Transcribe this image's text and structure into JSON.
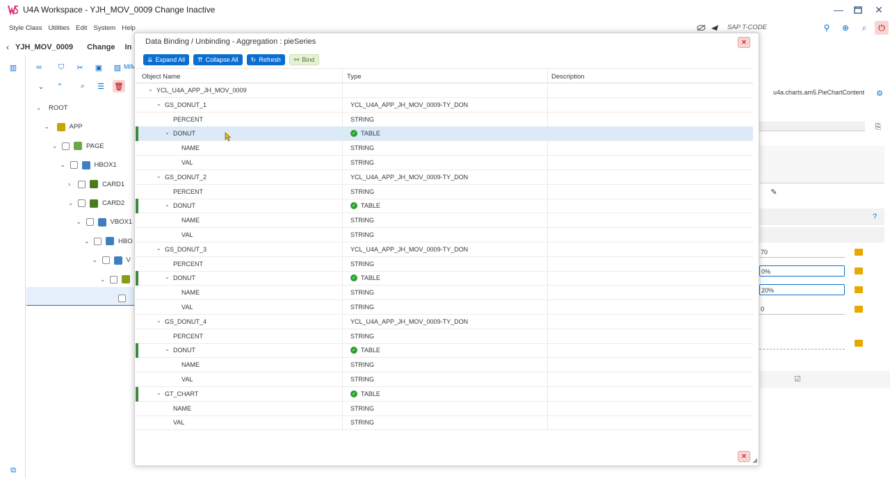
{
  "window": {
    "title": "U4A Workspace - YJH_MOV_0009 Change Inactive",
    "logo_text": "WS"
  },
  "menu": [
    "Style Class",
    "Utilities",
    "Edit",
    "System",
    "Help"
  ],
  "tcode_label": "SAP T-CODE",
  "header": {
    "program": "YJH_MOV_0009",
    "mode": "Change",
    "status_partial": "In"
  },
  "toolbar_partial_label": "MIM",
  "tree": [
    {
      "label": "ROOT",
      "chev": "⌄",
      "indent": 0,
      "checkbox": false,
      "icon": ""
    },
    {
      "label": "APP",
      "chev": "⌄",
      "indent": 1,
      "checkbox": false,
      "icon": "app-icon"
    },
    {
      "label": "PAGE",
      "chev": "⌄",
      "indent": 2,
      "checkbox": true,
      "icon": "page-icon"
    },
    {
      "label": "HBOX1",
      "chev": "⌄",
      "indent": 3,
      "checkbox": true,
      "icon": "hbox-icon"
    },
    {
      "label": "CARD1",
      "chev": "›",
      "indent": 4,
      "checkbox": true,
      "icon": "card-icon"
    },
    {
      "label": "CARD2",
      "chev": "⌄",
      "indent": 4,
      "checkbox": true,
      "icon": "card-icon"
    },
    {
      "label": "VBOX1",
      "chev": "⌄",
      "indent": 5,
      "checkbox": true,
      "icon": "vbox-icon"
    },
    {
      "label": "HBO",
      "chev": "⌄",
      "indent": 6,
      "checkbox": true,
      "icon": "hbox-icon"
    },
    {
      "label": "V",
      "chev": "⌄",
      "indent": 7,
      "checkbox": true,
      "icon": "vbox-icon"
    },
    {
      "label": "",
      "chev": "⌄",
      "indent": 8,
      "checkbox": true,
      "icon": "chart-icon"
    },
    {
      "label": "",
      "chev": "",
      "indent": 9,
      "checkbox": true,
      "icon": ""
    }
  ],
  "right_panel": {
    "class_path": "u4a.charts.am5.PieChartContent",
    "fields": [
      "70",
      "0%",
      "20%",
      "0"
    ]
  },
  "dialog": {
    "title": "Data Binding / Unbinding - Aggregation : pieSeries",
    "buttons": {
      "expand_all": "Expand All",
      "collapse_all": "Collapse All",
      "refresh": "Refresh",
      "bind": "Bind"
    },
    "columns": {
      "object_name": "Object Name",
      "type": "Type",
      "description": "Description"
    },
    "rows": [
      {
        "name": "YCL_U4A_APP_JH_MOV_0009",
        "type": "",
        "level": 0,
        "chev": "⌄",
        "ok": false,
        "mark": false
      },
      {
        "name": "GS_DONUT_1",
        "type": "YCL_U4A_APP_JH_MOV_0009-TY_DON",
        "level": 1,
        "chev": "⌄",
        "ok": false,
        "mark": false
      },
      {
        "name": "PERCENT",
        "type": "STRING",
        "level": 2,
        "chev": "",
        "ok": false,
        "mark": false
      },
      {
        "name": "DONUT",
        "type": "TABLE",
        "level": 2,
        "chev": "⌄",
        "ok": true,
        "mark": true,
        "highlight": true
      },
      {
        "name": "NAME",
        "type": "STRING",
        "level": 3,
        "chev": "",
        "ok": false,
        "mark": false
      },
      {
        "name": "VAL",
        "type": "STRING",
        "level": 3,
        "chev": "",
        "ok": false,
        "mark": false
      },
      {
        "name": "GS_DONUT_2",
        "type": "YCL_U4A_APP_JH_MOV_0009-TY_DON",
        "level": 1,
        "chev": "⌄",
        "ok": false,
        "mark": false
      },
      {
        "name": "PERCENT",
        "type": "STRING",
        "level": 2,
        "chev": "",
        "ok": false,
        "mark": false
      },
      {
        "name": "DONUT",
        "type": "TABLE",
        "level": 2,
        "chev": "⌄",
        "ok": true,
        "mark": true
      },
      {
        "name": "NAME",
        "type": "STRING",
        "level": 3,
        "chev": "",
        "ok": false,
        "mark": false
      },
      {
        "name": "VAL",
        "type": "STRING",
        "level": 3,
        "chev": "",
        "ok": false,
        "mark": false
      },
      {
        "name": "GS_DONUT_3",
        "type": "YCL_U4A_APP_JH_MOV_0009-TY_DON",
        "level": 1,
        "chev": "⌄",
        "ok": false,
        "mark": false
      },
      {
        "name": "PERCENT",
        "type": "STRING",
        "level": 2,
        "chev": "",
        "ok": false,
        "mark": false
      },
      {
        "name": "DONUT",
        "type": "TABLE",
        "level": 2,
        "chev": "⌄",
        "ok": true,
        "mark": true
      },
      {
        "name": "NAME",
        "type": "STRING",
        "level": 3,
        "chev": "",
        "ok": false,
        "mark": false
      },
      {
        "name": "VAL",
        "type": "STRING",
        "level": 3,
        "chev": "",
        "ok": false,
        "mark": false
      },
      {
        "name": "GS_DONUT_4",
        "type": "YCL_U4A_APP_JH_MOV_0009-TY_DON",
        "level": 1,
        "chev": "⌄",
        "ok": false,
        "mark": false
      },
      {
        "name": "PERCENT",
        "type": "STRING",
        "level": 2,
        "chev": "",
        "ok": false,
        "mark": false
      },
      {
        "name": "DONUT",
        "type": "TABLE",
        "level": 2,
        "chev": "⌄",
        "ok": true,
        "mark": true
      },
      {
        "name": "NAME",
        "type": "STRING",
        "level": 3,
        "chev": "",
        "ok": false,
        "mark": false
      },
      {
        "name": "VAL",
        "type": "STRING",
        "level": 3,
        "chev": "",
        "ok": false,
        "mark": false
      },
      {
        "name": "GT_CHART",
        "type": "TABLE",
        "level": 1,
        "chev": "⌄",
        "ok": true,
        "mark": true
      },
      {
        "name": "NAME",
        "type": "STRING",
        "level": 2,
        "chev": "",
        "ok": false,
        "mark": false
      },
      {
        "name": "VAL",
        "type": "STRING",
        "level": 2,
        "chev": "",
        "ok": false,
        "mark": false
      }
    ]
  },
  "colors": {
    "accent": "#0a6ed1",
    "success": "#2b9f2b",
    "danger": "#bb0000",
    "highlight": "#dceaf7"
  }
}
